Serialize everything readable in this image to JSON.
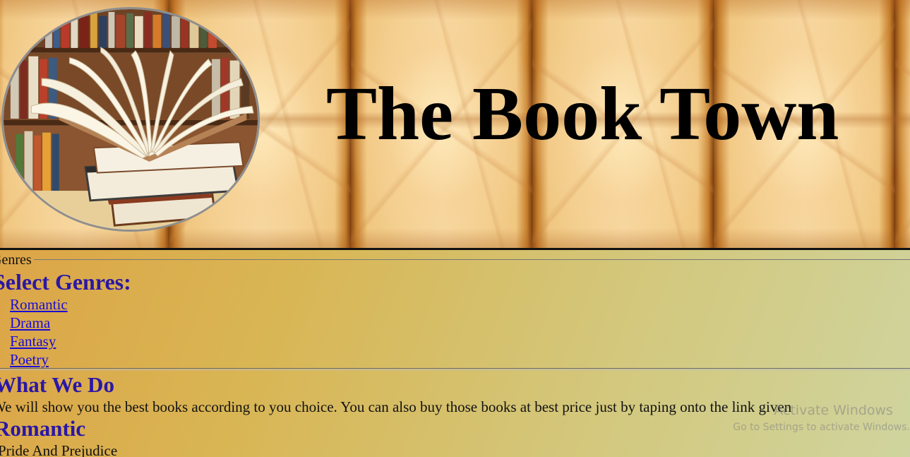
{
  "header": {
    "title": "The Book Town",
    "logo_icon": "books-stack-photo"
  },
  "genres_section": {
    "legend": "Genres",
    "heading": "Select Genres:",
    "items": [
      {
        "label": "Romantic"
      },
      {
        "label": "Drama"
      },
      {
        "label": "Fantasy"
      },
      {
        "label": "Poetry"
      }
    ]
  },
  "what_we_do": {
    "heading": "What We Do",
    "text": "We will show you the best books according to you choice. You can also buy those books at best price just by taping onto the link given"
  },
  "romantic_section": {
    "heading": "Romantic",
    "items": [
      {
        "label": "Pride And Prejudice"
      }
    ]
  },
  "watermark": {
    "title": "Activate Windows",
    "subtitle": "Go to Settings to activate Windows."
  },
  "colors": {
    "heading": "#2a17a6",
    "link": "#1a0dd6",
    "banner": "#f2c886"
  }
}
